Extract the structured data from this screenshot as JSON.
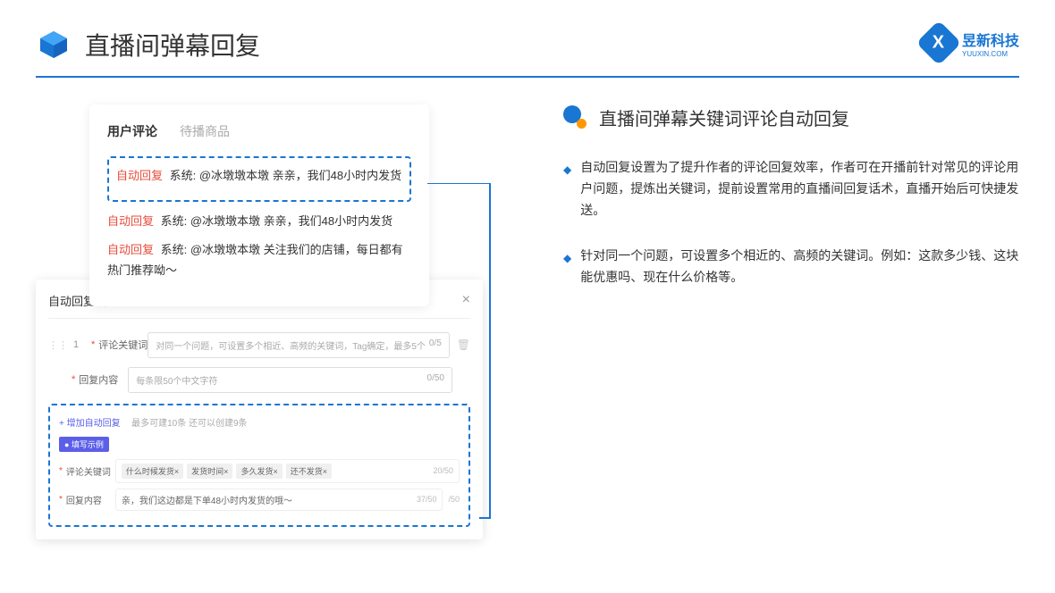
{
  "header": {
    "title": "直播间弹幕回复"
  },
  "logo": {
    "name": "昱新科技",
    "sub": "YUUXIN.COM"
  },
  "comments": {
    "tab_active": "用户评论",
    "tab_inactive": "待播商品",
    "items": [
      {
        "label": "自动回复",
        "text": "系统: @冰墩墩本墩 亲亲，我们48小时内发货",
        "hl": true
      },
      {
        "label": "自动回复",
        "text": "系统: @冰墩墩本墩 亲亲，我们48小时内发货",
        "hl": false
      },
      {
        "label": "自动回复",
        "text": "系统: @冰墩墩本墩 关注我们的店铺，每日都有热门推荐呦～",
        "hl": false
      }
    ]
  },
  "settings": {
    "title": "自动回复设置",
    "row_num": "1",
    "keyword_label": "评论关键词",
    "keyword_placeholder": "对同一个问题，可设置多个相近、高频的关键词，Tag确定，最多5个",
    "keyword_count": "0/5",
    "content_label": "回复内容",
    "content_placeholder": "每条限50个中文字符",
    "content_count": "0/50",
    "add_link": "+ 增加自动回复",
    "add_hint": "最多可建10条 还可以创建9条",
    "example_badge": "● 填写示例",
    "ex": {
      "kw_label": "评论关键词",
      "tags": [
        "什么时候发货×",
        "发货时间×",
        "多久发货×",
        "还不发货×"
      ],
      "kw_count": "20/50",
      "ct_label": "回复内容",
      "ct_text": "亲，我们这边都是下单48小时内发货的哦～",
      "ct_count": "37/50",
      "outer_count": "/50"
    }
  },
  "right": {
    "title": "直播间弹幕关键词评论自动回复",
    "bullets": [
      "自动回复设置为了提升作者的评论回复效率，作者可在开播前针对常见的评论用户问题，提炼出关键词，提前设置常用的直播间回复话术，直播开始后可快捷发送。",
      "针对同一个问题，可设置多个相近的、高频的关键词。例如：这款多少钱、这块能优惠吗、现在什么价格等。"
    ]
  }
}
